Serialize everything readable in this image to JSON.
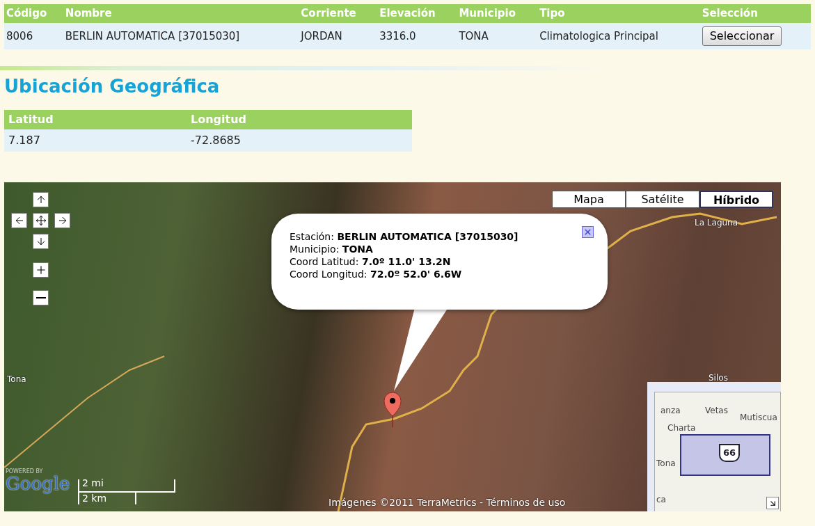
{
  "station_table": {
    "columns": [
      "Código",
      "Nombre",
      "Corriente",
      "Elevación",
      "Municipio",
      "Tipo",
      "Selección"
    ],
    "rows": [
      {
        "cells": [
          "8006",
          "BERLIN AUTOMATICA [37015030]",
          "JORDAN",
          "3316.0",
          "TONA",
          "Climatologica Principal"
        ],
        "button": "Seleccionar"
      }
    ]
  },
  "section_title": "Ubicación Geográfica",
  "coords_table": {
    "columns": [
      "Latitud",
      "Longitud"
    ],
    "rows": [
      [
        "7.187",
        "-72.8685"
      ]
    ]
  },
  "map": {
    "map_types": [
      {
        "label": "Mapa",
        "selected": false
      },
      {
        "label": "Satélite",
        "selected": false
      },
      {
        "label": "Híbrido",
        "selected": true
      }
    ],
    "place_labels": [
      "La Laguna",
      "Tona",
      "Silos"
    ],
    "info_window": {
      "lines": [
        {
          "label": "Estación:",
          "value": "BERLIN AUTOMATICA [37015030]"
        },
        {
          "label": "Municipio:",
          "value": "TONA"
        },
        {
          "label": "Coord Latitud:",
          "value": "7.0º 11.0' 13.2N"
        },
        {
          "label": "Coord Longitud:",
          "value": "72.0º 52.0' 6.6W"
        }
      ]
    },
    "scale": {
      "upper": "2 mi",
      "lower": "2 km"
    },
    "logo_caption": "POWERED BY",
    "logo": "Google",
    "attribution": "Imágenes ©2011 TerraMetrics - Términos de uso",
    "overview": {
      "labels": [
        "anza",
        "Vetas",
        "Mutiscua",
        "Charta",
        "Tona",
        "ca"
      ],
      "shield": "66"
    }
  }
}
